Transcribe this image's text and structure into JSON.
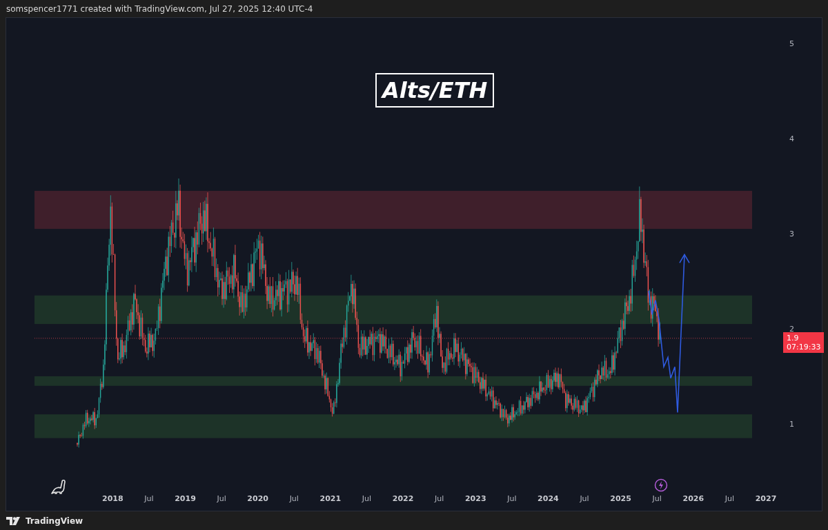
{
  "header": {
    "text": "somspencer1771 created with TradingView.com, Jul 27, 2025 12:40 UTC-4"
  },
  "chart": {
    "title": "Alts/ETH",
    "price_axis": [
      "5",
      "4",
      "3",
      "2",
      "1"
    ],
    "last_price": {
      "value": "1.9",
      "countdown": "07:19:33"
    },
    "time_axis": [
      "2018",
      "Jul",
      "2019",
      "Jul",
      "2020",
      "Jul",
      "2021",
      "Jul",
      "2022",
      "Jul",
      "2023",
      "Jul",
      "2024",
      "Jul",
      "2025",
      "Jul",
      "2026",
      "Jul",
      "2027"
    ]
  },
  "footer": {
    "brand": "TradingView"
  }
}
